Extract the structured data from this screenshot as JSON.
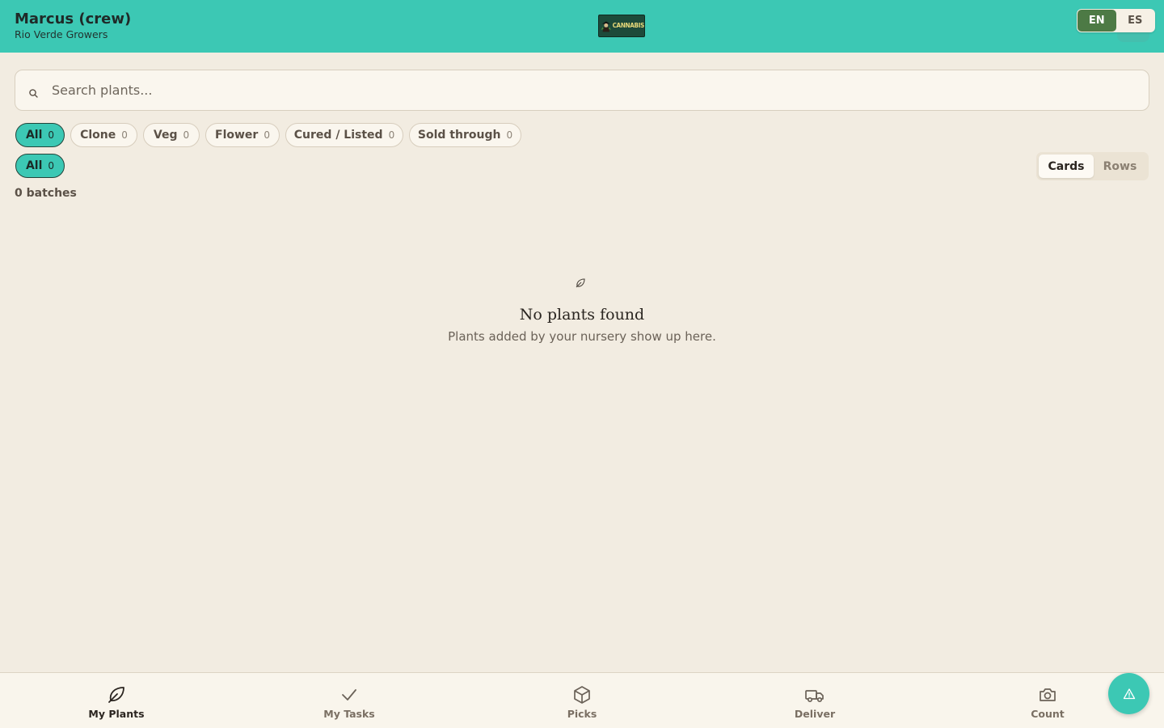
{
  "header": {
    "user_name": "Marcus (crew)",
    "org_name": "Rio Verde Growers",
    "logo_text": "CANNABIS",
    "languages": [
      "EN",
      "ES"
    ],
    "active_language": "EN",
    "accent_color": "#3cc8b4"
  },
  "search": {
    "placeholder": "Search plants...",
    "value": "",
    "icon": "search-icon"
  },
  "stage_filters": [
    {
      "label": "All",
      "count": "0",
      "active": true
    },
    {
      "label": "Clone",
      "count": "0",
      "active": false
    },
    {
      "label": "Veg",
      "count": "0",
      "active": false
    },
    {
      "label": "Flower",
      "count": "0",
      "active": false
    },
    {
      "label": "Cured / Listed",
      "count": "0",
      "active": false
    },
    {
      "label": "Sold through",
      "count": "0",
      "active": false
    }
  ],
  "secondary_filters": [
    {
      "label": "All",
      "count": "0",
      "active": true
    }
  ],
  "view_toggle": {
    "options": [
      "Cards",
      "Rows"
    ],
    "active": "Cards"
  },
  "batch_count": "0 batches",
  "empty_state": {
    "icon": "leaf-icon",
    "title": "No plants found",
    "subtitle": "Plants added by your nursery show up here."
  },
  "bottom_nav": [
    {
      "label": "My Plants",
      "icon": "leaf-icon",
      "active": true
    },
    {
      "label": "My Tasks",
      "icon": "check-icon",
      "active": false
    },
    {
      "label": "Picks",
      "icon": "box-icon",
      "active": false
    },
    {
      "label": "Deliver",
      "icon": "truck-icon",
      "active": false
    },
    {
      "label": "Count",
      "icon": "camera-icon",
      "active": false
    }
  ],
  "fab": {
    "icon": "alert-triangle-icon"
  }
}
